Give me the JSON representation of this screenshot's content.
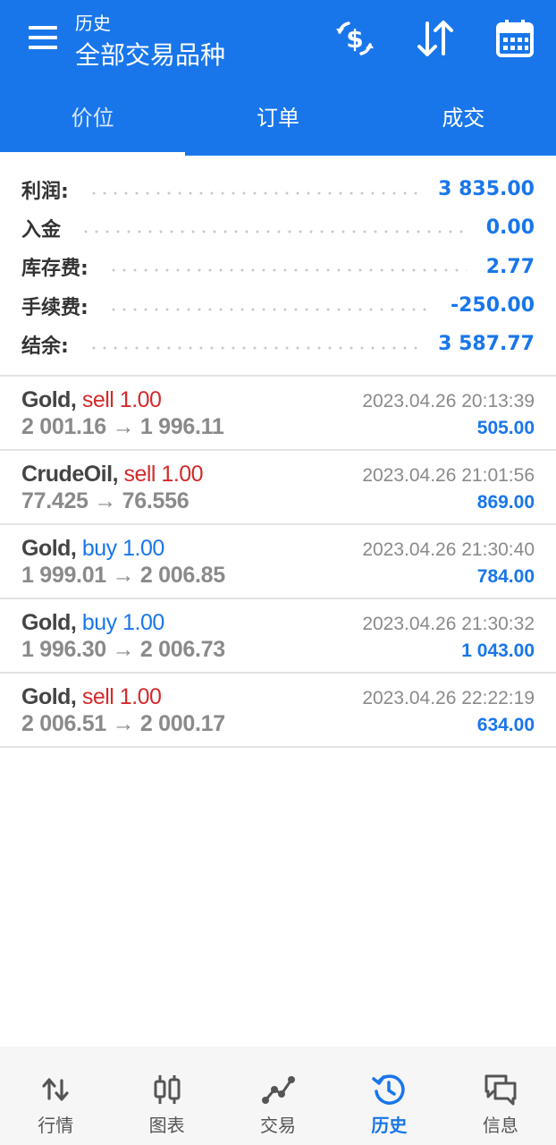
{
  "header": {
    "subtitle": "历史",
    "title": "全部交易品种"
  },
  "tabs": [
    {
      "label": "价位",
      "active": true
    },
    {
      "label": "订单",
      "active": false
    },
    {
      "label": "成交",
      "active": false
    }
  ],
  "summary": [
    {
      "label": "利润:",
      "value": "3 835.00"
    },
    {
      "label": "入金",
      "value": "0.00"
    },
    {
      "label": "库存费:",
      "value": "2.77"
    },
    {
      "label": "手续费:",
      "value": "-250.00"
    },
    {
      "label": "结余:",
      "value": "3 587.77"
    }
  ],
  "trades": [
    {
      "symbol": "Gold,",
      "side": "sell 1.00",
      "side_type": "sell",
      "prices": "2 001.16 → 1 996.11",
      "time": "2023.04.26 20:13:39",
      "profit": "505.00"
    },
    {
      "symbol": "CrudeOil,",
      "side": "sell 1.00",
      "side_type": "sell",
      "prices": "77.425 → 76.556",
      "time": "2023.04.26 21:01:56",
      "profit": "869.00"
    },
    {
      "symbol": "Gold,",
      "side": "buy 1.00",
      "side_type": "buy",
      "prices": "1 999.01 → 2 006.85",
      "time": "2023.04.26 21:30:40",
      "profit": "784.00"
    },
    {
      "symbol": "Gold,",
      "side": "buy 1.00",
      "side_type": "buy",
      "prices": "1 996.30 → 2 006.73",
      "time": "2023.04.26 21:30:32",
      "profit": "1 043.00"
    },
    {
      "symbol": "Gold,",
      "side": "sell 1.00",
      "side_type": "sell",
      "prices": "2 006.51 → 2 000.17",
      "time": "2023.04.26 22:22:19",
      "profit": "634.00"
    }
  ],
  "bottom_nav": [
    {
      "label": "行情",
      "icon": "quotes-icon",
      "active": false
    },
    {
      "label": "图表",
      "icon": "chart-icon",
      "active": false
    },
    {
      "label": "交易",
      "icon": "trade-icon",
      "active": false
    },
    {
      "label": "历史",
      "icon": "history-icon",
      "active": true
    },
    {
      "label": "信息",
      "icon": "messages-icon",
      "active": false
    }
  ],
  "colors": {
    "primary": "#1976ea",
    "sell": "#d32a2a",
    "buy": "#1976ea",
    "muted": "#8a8a8a"
  }
}
